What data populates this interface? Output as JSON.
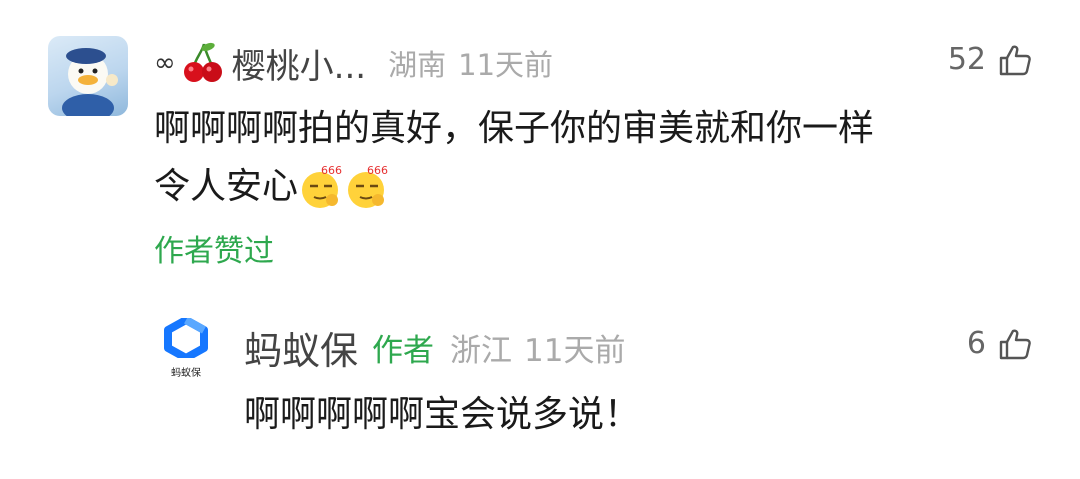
{
  "comment": {
    "username": "樱桃小...",
    "username_prefix_icon": "infinity-icon",
    "username_badge_icon": "cherry-icon",
    "location": "湖南",
    "time": "11天前",
    "likes": "52",
    "text_line1": "啊啊啊啊拍的真好，保子你的审美就和你一样",
    "text_line2": "令人安心",
    "emojis": [
      "666-emoji",
      "666-emoji"
    ],
    "author_liked": "作者赞过"
  },
  "reply": {
    "username": "蚂蚁保",
    "avatar_label": "蚂蚁保",
    "author_tag": "作者",
    "location": "浙江",
    "time": "11天前",
    "likes": "6",
    "text": "啊啊啊啊啊宝会说多说！"
  },
  "colors": {
    "accent_green": "#2ea84e",
    "meta_gray": "#aaaaaa",
    "brand_blue": "#1677ff"
  }
}
